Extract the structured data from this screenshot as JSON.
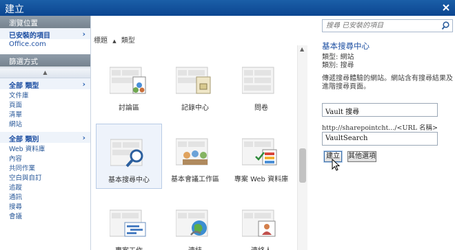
{
  "window": {
    "title": "建立"
  },
  "nav": {
    "browse_header": "瀏覽位置",
    "installed": "已安裝的項目",
    "office": "Office.com",
    "filter_header": "篩選方式",
    "all_types": "全部 類型",
    "types": [
      "文件庫",
      "頁面",
      "清單",
      "網站"
    ],
    "all_categories": "全部 類別",
    "categories": [
      "Web 資料庫",
      "內容",
      "共同作業",
      "空白與自訂",
      "追蹤",
      "通訊",
      "搜尋",
      "會議"
    ]
  },
  "sort": {
    "title": "標題",
    "type": "類型"
  },
  "gallery": {
    "items": [
      {
        "label": "討論區",
        "icon": "discussion-board-icon"
      },
      {
        "label": "記錄中心",
        "icon": "records-center-icon"
      },
      {
        "label": "問卷",
        "icon": "survey-icon"
      },
      {
        "label": "基本搜尋中心",
        "icon": "basic-search-center-icon",
        "selected": true
      },
      {
        "label": "基本會議工作區",
        "icon": "basic-meeting-workspace-icon"
      },
      {
        "label": "專案 Web 資料庫",
        "icon": "projects-web-database-icon"
      },
      {
        "label": "專案工作",
        "icon": "project-tasks-icon"
      },
      {
        "label": "連結",
        "icon": "links-icon"
      },
      {
        "label": "連絡人",
        "icon": "contacts-icon"
      }
    ]
  },
  "details": {
    "search_placeholder": "搜尋 已安裝的項目",
    "title": "基本搜尋中心",
    "type_line": "類型: 網站",
    "category_line": "類別: 搜尋",
    "description": "傳遞搜尋體驗的網站。網站含有搜尋結果及進階搜尋頁面。",
    "name_value": "Vault 搜尋",
    "url_label": "http://sharepointcht.../<URL 名稱>",
    "url_value": "VaultSearch",
    "create_label": "建立",
    "more_label": "其他選項"
  }
}
